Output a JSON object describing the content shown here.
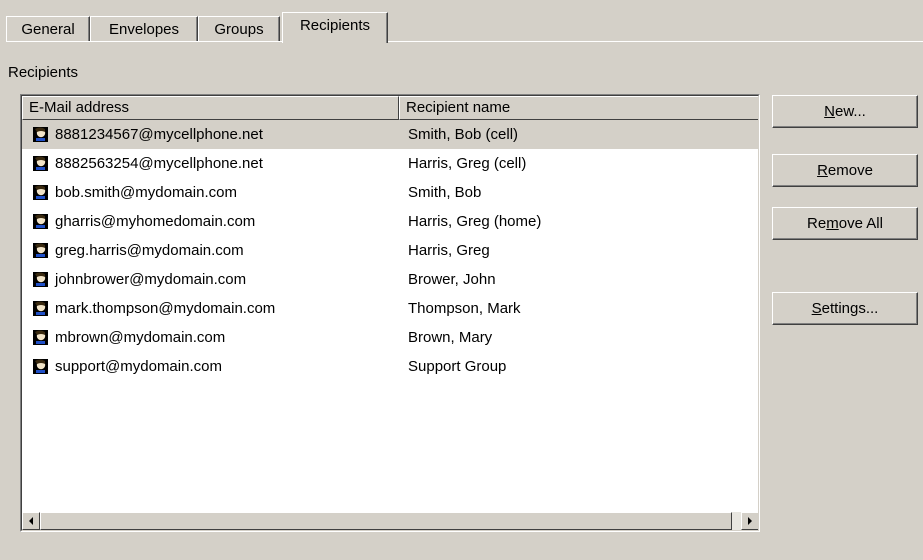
{
  "tabs": [
    {
      "label": "General"
    },
    {
      "label": "Envelopes"
    },
    {
      "label": "Groups"
    },
    {
      "label": "Recipients"
    }
  ],
  "active_tab": "Recipients",
  "section_label": "Recipients",
  "list": {
    "columns": [
      "E-Mail address",
      "Recipient name"
    ],
    "rows": [
      {
        "email": "8881234567@mycellphone.net",
        "name": "Smith, Bob (cell)",
        "selected": true
      },
      {
        "email": "8882563254@mycellphone.net",
        "name": "Harris, Greg (cell)"
      },
      {
        "email": "bob.smith@mydomain.com",
        "name": "Smith, Bob"
      },
      {
        "email": "gharris@myhomedomain.com",
        "name": "Harris, Greg (home)"
      },
      {
        "email": "greg.harris@mydomain.com",
        "name": "Harris, Greg"
      },
      {
        "email": "johnbrower@mydomain.com",
        "name": "Brower, John"
      },
      {
        "email": "mark.thompson@mydomain.com",
        "name": "Thompson, Mark"
      },
      {
        "email": "mbrown@mydomain.com",
        "name": "Brown, Mary"
      },
      {
        "email": "support@mydomain.com",
        "name": "Support Group"
      }
    ],
    "row_icon": "person-icon"
  },
  "buttons": {
    "new": {
      "pre": "",
      "mnemonic": "N",
      "post": "ew..."
    },
    "remove": {
      "pre": "",
      "mnemonic": "R",
      "post": "emove"
    },
    "remove_all": {
      "pre": "Re",
      "mnemonic": "m",
      "post": "ove All"
    },
    "settings": {
      "pre": "",
      "mnemonic": "S",
      "post": "ettings..."
    }
  },
  "colors": {
    "face": "#d4d0c8",
    "selected_row": "#d4d0c8"
  }
}
